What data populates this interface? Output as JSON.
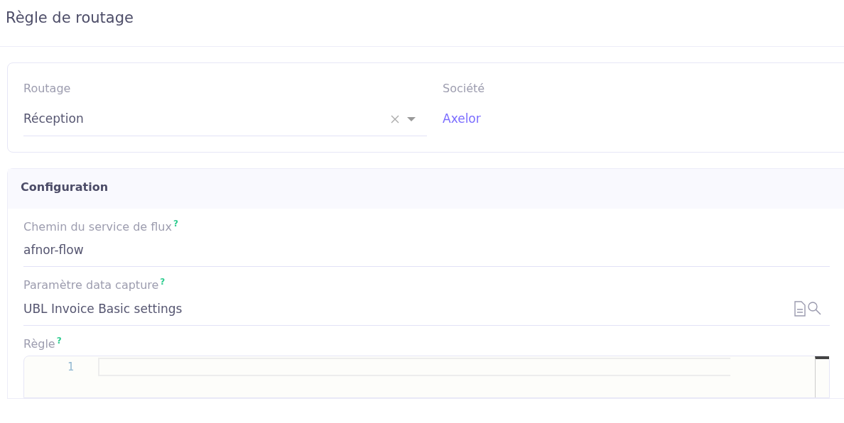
{
  "title": "Règle de routage",
  "top_fields": [
    {
      "kind": "select",
      "label": "Routage",
      "value": "Réception"
    },
    {
      "kind": "link",
      "label": "Société",
      "value": "Axelor"
    }
  ],
  "section": {
    "title": "Configuration",
    "fields": [
      {
        "kind": "text",
        "label": "Chemin du service de flux",
        "help": "?",
        "value": "afnor-flow"
      },
      {
        "kind": "relation",
        "label": "Paramètre data capture",
        "help": "?",
        "value": "UBL Invoice Basic settings"
      },
      {
        "kind": "code",
        "label": "Règle",
        "help": "?",
        "line_numbers": [
          "1"
        ]
      }
    ]
  }
}
